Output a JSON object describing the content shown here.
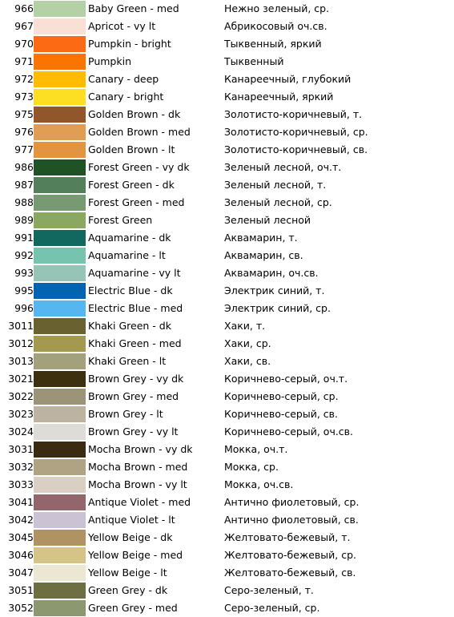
{
  "table": {
    "columns": [
      "code",
      "swatch",
      "name_en",
      "name_ru"
    ],
    "rows": [
      {
        "code": "966",
        "color": "#b3d1a5",
        "name_en": "Baby Green - med",
        "name_ru": "Нежно зеленый, ср."
      },
      {
        "code": "967",
        "color": "#fadfd4",
        "name_en": "Apricot - vy lt",
        "name_ru": "Абрикосовый оч.св."
      },
      {
        "code": "970",
        "color": "#fc6a14",
        "name_en": "Pumpkin - bright",
        "name_ru": "Тыквенный, яркий"
      },
      {
        "code": "971",
        "color": "#fb7400",
        "name_en": "Pumpkin",
        "name_ru": "Тыквенный"
      },
      {
        "code": "972",
        "color": "#ffbc00",
        "name_en": "Canary - deep",
        "name_ru": "Канареечный, глубокий"
      },
      {
        "code": "973",
        "color": "#fcdf22",
        "name_en": "Canary - bright",
        "name_ru": "Канареечный, яркий"
      },
      {
        "code": "975",
        "color": "#91572a",
        "name_en": "Golden Brown - dk",
        "name_ru": "Золотисто-коричневый, т."
      },
      {
        "code": "976",
        "color": "#e09e55",
        "name_en": "Golden Brown - med",
        "name_ru": "Золотисто-коричневый, ср."
      },
      {
        "code": "977",
        "color": "#e29441",
        "name_en": "Golden Brown - lt",
        "name_ru": "Золотисто-коричневый, св."
      },
      {
        "code": "986",
        "color": "#1f5225",
        "name_en": "Forest Green - vy dk",
        "name_ru": "Зеленый лесной, оч.т."
      },
      {
        "code": "987",
        "color": "#53805a",
        "name_en": "Forest Green - dk",
        "name_ru": "Зеленый лесной, т."
      },
      {
        "code": "988",
        "color": "#789a72",
        "name_en": "Forest Green - med",
        "name_ru": "Зеленый лесной, ср."
      },
      {
        "code": "989",
        "color": "#8aa85f",
        "name_en": "Forest Green",
        "name_ru": "Зеленый лесной"
      },
      {
        "code": "991",
        "color": "#12685e",
        "name_en": "Aquamarine - dk",
        "name_ru": "Аквамарин, т."
      },
      {
        "code": "992",
        "color": "#76c4b0",
        "name_en": "Aquamarine - lt",
        "name_ru": "Аквамарин, св."
      },
      {
        "code": "993",
        "color": "#96c4b6",
        "name_en": "Aquamarine - vy lt",
        "name_ru": "Аквамарин, оч.св."
      },
      {
        "code": "995",
        "color": "#0064b0",
        "name_en": "Electric Blue - dk",
        "name_ru": "Электрик синий, т."
      },
      {
        "code": "996",
        "color": "#56b6ef",
        "name_en": "Electric Blue - med",
        "name_ru": "Электрик синий, ср."
      },
      {
        "code": "3011",
        "color": "#6a6130",
        "name_en": "Khaki Green - dk",
        "name_ru": "Хаки, т."
      },
      {
        "code": "3012",
        "color": "#a39a4f",
        "name_en": "Khaki Green - med",
        "name_ru": "Хаки, ср."
      },
      {
        "code": "3013",
        "color": "#a3a07c",
        "name_en": "Khaki Green - lt",
        "name_ru": "Хаки, св."
      },
      {
        "code": "3021",
        "color": "#3d300f",
        "name_en": "Brown Grey - vy dk",
        "name_ru": "Коричнево-серый, оч.т."
      },
      {
        "code": "3022",
        "color": "#9b9479",
        "name_en": "Brown Grey - med",
        "name_ru": "Коричнево-серый, ср."
      },
      {
        "code": "3023",
        "color": "#bcb4a1",
        "name_en": "Brown Grey - lt",
        "name_ru": "Коричнево-серый, св."
      },
      {
        "code": "3024",
        "color": "#dddcd6",
        "name_en": "Brown Grey - vy lt",
        "name_ru": "Коричнево-серый, оч.св."
      },
      {
        "code": "3031",
        "color": "#3b2a12",
        "name_en": "Mocha Brown - vy dk",
        "name_ru": "Мокка, оч.т."
      },
      {
        "code": "3032",
        "color": "#b0a384",
        "name_en": "Mocha Brown - med",
        "name_ru": "Мокка, ср."
      },
      {
        "code": "3033",
        "color": "#d9cfc2",
        "name_en": "Mocha Brown - vy lt",
        "name_ru": "Мокка, оч.св."
      },
      {
        "code": "3041",
        "color": "#93666c",
        "name_en": "Antique Violet - med",
        "name_ru": "Антично фиолетовый, ср."
      },
      {
        "code": "3042",
        "color": "#cbc3d3",
        "name_en": "Antique Violet - lt",
        "name_ru": "Антично фиолетовый, св."
      },
      {
        "code": "3045",
        "color": "#b09363",
        "name_en": "Yellow Beige - dk",
        "name_ru": "Желтовато-бежевый, т."
      },
      {
        "code": "3046",
        "color": "#d6c388",
        "name_en": "Yellow Beige - med",
        "name_ru": "Желтовато-бежевый, ср."
      },
      {
        "code": "3047",
        "color": "#ebe7d2",
        "name_en": "Yellow Beige - lt",
        "name_ru": "Желтовато-бежевый, св."
      },
      {
        "code": "3051",
        "color": "#6d6e42",
        "name_en": "Green Grey - dk",
        "name_ru": "Серо-зеленый, т."
      },
      {
        "code": "3052",
        "color": "#8c9970",
        "name_en": "Green Grey - med",
        "name_ru": "Серо-зеленый, ср."
      }
    ]
  }
}
